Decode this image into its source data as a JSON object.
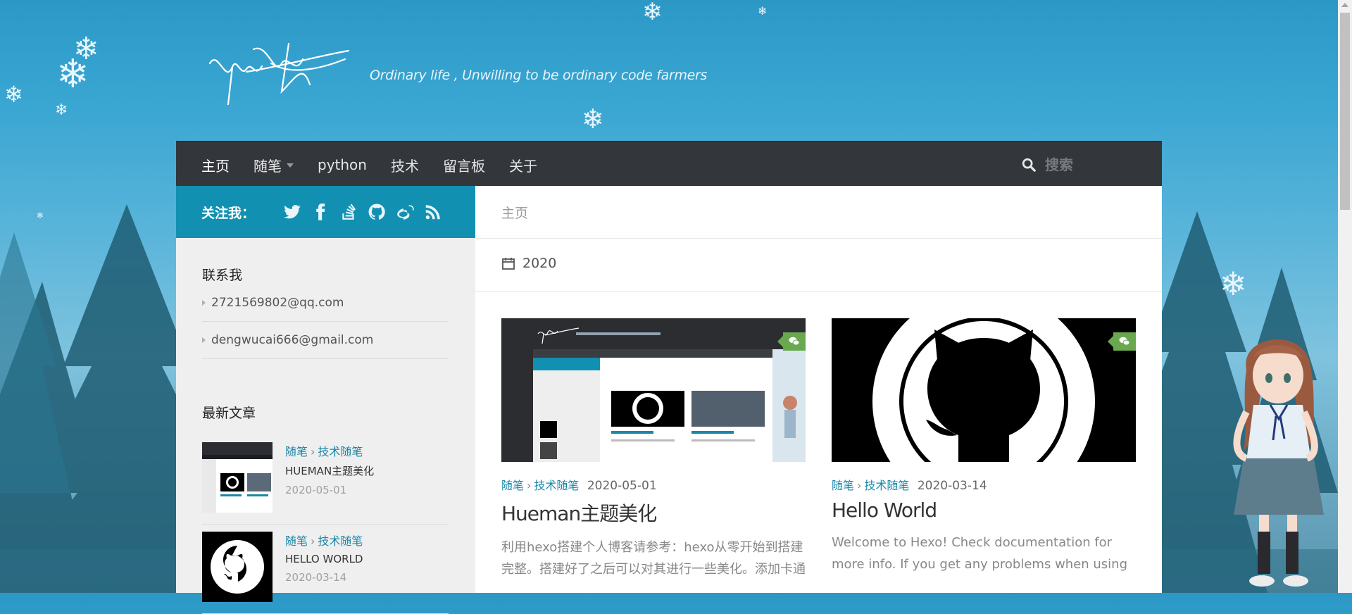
{
  "header": {
    "tagline": "Ordinary life , Unwilling to be ordinary code farmers"
  },
  "nav": {
    "items": [
      {
        "label": "主页",
        "active": true
      },
      {
        "label": "随笔",
        "dropdown": true
      },
      {
        "label": "python"
      },
      {
        "label": "技术"
      },
      {
        "label": "留言板"
      },
      {
        "label": "关于"
      }
    ],
    "search_placeholder": "搜索"
  },
  "sidebar": {
    "follow_label": "关注我：",
    "social_icons": [
      "twitter-icon",
      "facebook-icon",
      "stackoverflow-icon",
      "github-icon",
      "weibo-icon",
      "rss-icon"
    ],
    "contact_title": "联系我",
    "contacts": [
      "2721569802@qq.com",
      "dengwucai666@gmail.com"
    ],
    "recent_title": "最新文章",
    "recent_posts": [
      {
        "cat1": "随笔",
        "cat2": "技术随笔",
        "title": "HUEMAN主题美化",
        "date": "2020-05-01"
      },
      {
        "cat1": "随笔",
        "cat2": "技术随笔",
        "title": "HELLO WORLD",
        "date": "2020-03-14"
      }
    ]
  },
  "content": {
    "breadcrumb": "主页",
    "archive_year": "2020",
    "posts": [
      {
        "cat1": "随笔",
        "cat2": "技术随笔",
        "date": "2020-05-01",
        "title": "Hueman主题美化",
        "excerpt": "利用hexo搭建个人博客请参考：hexo从零开始到搭建完整。搭建好了之后可以对其进行一些美化。添加卡通人物我们可以在博客的右下角添加"
      },
      {
        "cat1": "随笔",
        "cat2": "技术随笔",
        "date": "2020-03-14",
        "title": "Hello World",
        "excerpt": "Welcome to Hexo! Check documentation for more info. If you get any problems when using Hexo, you can find the answer in troubleshooting or you can"
      }
    ]
  },
  "colors": {
    "accent": "#1290b2",
    "nav_bg": "#33363b",
    "comment_badge": "#6aa84f"
  }
}
